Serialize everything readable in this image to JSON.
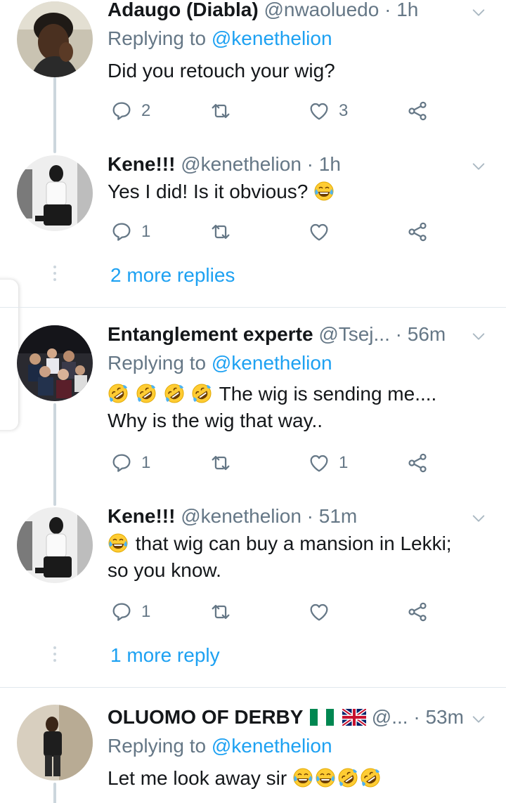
{
  "tweets": [
    {
      "name": "Adaugo (Diabla)",
      "handle": "@nwaoluedo",
      "time": "· 1h",
      "replying_prefix": "Replying to ",
      "replying_to": "@kenethelion",
      "text": "Did you retouch your wig?",
      "replies": "2",
      "retweets": "",
      "likes": "3"
    },
    {
      "name": "Kene!!!",
      "handle": "@kenethelion",
      "time": "· 1h",
      "text": "Yes I did! Is it obvious?",
      "replies": "1",
      "retweets": "",
      "likes": ""
    },
    {
      "name": "Entanglement experte",
      "handle": "@Tsej...",
      "time": "· 56m",
      "replying_prefix": "Replying to ",
      "replying_to": "@kenethelion",
      "text_line1": "The wig is sending me....",
      "text_line2": "Why is the wig that way..",
      "replies": "1",
      "retweets": "",
      "likes": "1"
    },
    {
      "name": "Kene!!!",
      "handle": "@kenethelion",
      "time": "· 51m",
      "text_line1": "that wig can buy a mansion in Lekki;",
      "text_line2": "so you know.",
      "replies": "1",
      "retweets": "",
      "likes": ""
    },
    {
      "name": "OLUOMO OF DERBY",
      "handle": "@...",
      "time": "· 53m",
      "replying_prefix": "Replying to ",
      "replying_to": "@kenethelion",
      "text": "Let me look away sir"
    }
  ],
  "more_replies": [
    "2 more replies",
    "1 more reply"
  ],
  "colors": {
    "accent": "#1da1f2",
    "secondary_text": "#657786",
    "thread_line": "#ccd6dd",
    "divider": "#e1e8ed"
  },
  "icons": [
    "reply-icon",
    "retweet-icon",
    "like-icon",
    "share-icon",
    "chevron-down-icon",
    "joy-emoji",
    "rofl-emoji",
    "nigeria-flag",
    "uk-flag"
  ]
}
